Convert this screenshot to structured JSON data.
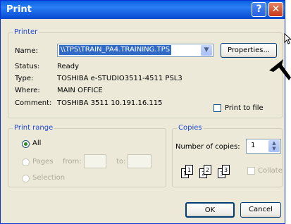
{
  "window": {
    "title": "Print",
    "help_glyph": "?",
    "close_glyph": "✕"
  },
  "printer": {
    "legend": "Printer",
    "name_label": "Name:",
    "name_value": "\\\\TPS\\TRAIN_PA4.TRAINING.TPS",
    "properties_label": "Properties...",
    "status_label": "Status:",
    "status_value": "Ready",
    "type_label": "Type:",
    "type_value": "TOSHIBA e-STUDIO3511-4511 PSL3",
    "where_label": "Where:",
    "where_value": "MAIN OFFICE",
    "comment_label": "Comment:",
    "comment_value": "TOSHIBA 3511  10.191.16.115",
    "print_to_file_label": "Print to file",
    "print_to_file_checked": false
  },
  "print_range": {
    "legend": "Print range",
    "all_label": "All",
    "pages_label": "Pages",
    "from_label": "from:",
    "to_label": "to:",
    "selection_label": "Selection"
  },
  "copies": {
    "legend": "Copies",
    "number_label": "Number of copies:",
    "number_value": "1",
    "collate_label": "Collate",
    "page_glyphs": [
      "1",
      "1",
      "2",
      "2",
      "3",
      "3"
    ]
  },
  "buttons": {
    "ok": "OK",
    "cancel": "Cancel"
  }
}
